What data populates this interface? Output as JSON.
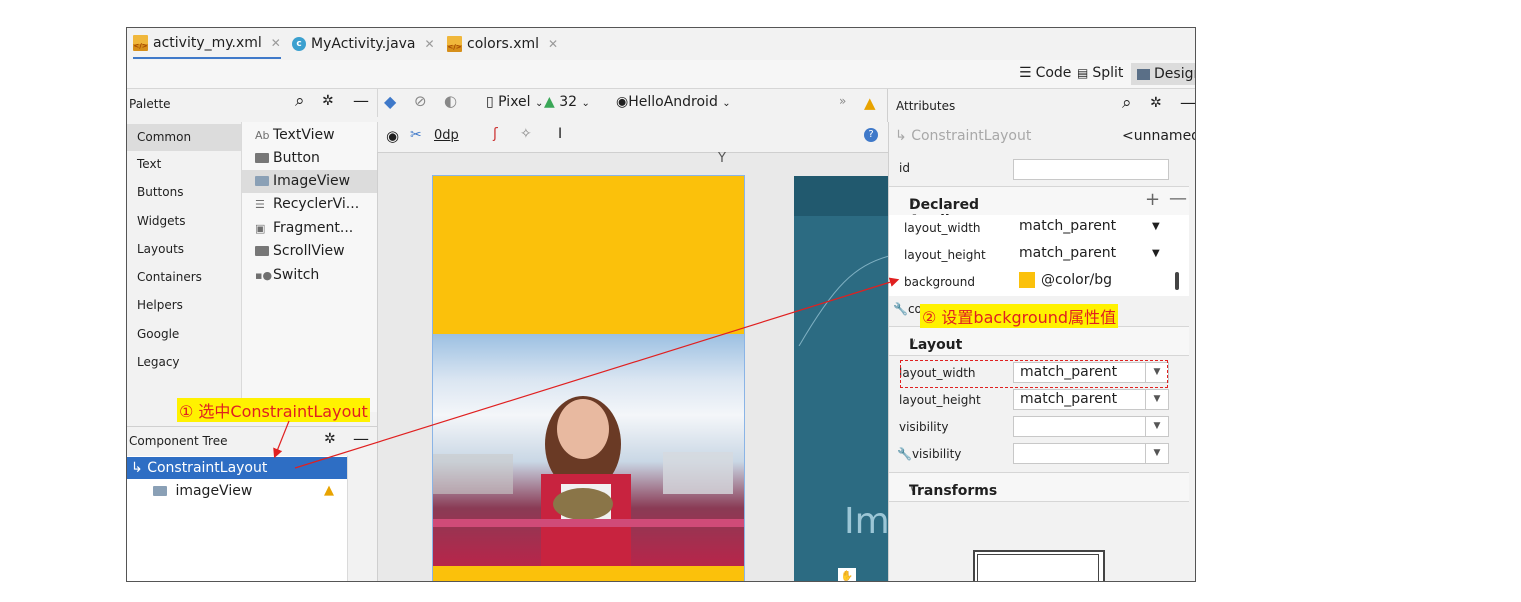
{
  "tabs": [
    {
      "label": "activity_my.xml",
      "active": true
    },
    {
      "label": "MyActivity.java",
      "active": false
    },
    {
      "label": "colors.xml",
      "active": false
    }
  ],
  "modes": {
    "code": "Code",
    "split": "Split",
    "design": "Design"
  },
  "palette": {
    "title": "Palette",
    "categories": [
      "Common",
      "Text",
      "Buttons",
      "Widgets",
      "Layouts",
      "Containers",
      "Helpers",
      "Google",
      "Legacy"
    ],
    "items": [
      {
        "icon": "Ab",
        "label": "TextView"
      },
      {
        "icon": "button",
        "label": "Button"
      },
      {
        "icon": "image",
        "label": "ImageView"
      },
      {
        "icon": "list",
        "label": "RecyclerVi..."
      },
      {
        "icon": "fragment",
        "label": "Fragment..."
      },
      {
        "icon": "scroll",
        "label": "ScrollView"
      },
      {
        "icon": "switch",
        "label": "Switch"
      }
    ]
  },
  "design_toolbar": {
    "device": "Pixel",
    "api": "32",
    "theme": "HelloAndroid",
    "margin": "0dp"
  },
  "component_tree": {
    "title": "Component Tree",
    "nodes": [
      {
        "label": "ConstraintLayout",
        "selected": true
      },
      {
        "label": "imageView",
        "selected": false,
        "warning": true
      }
    ]
  },
  "attributes": {
    "title": "Attributes",
    "component": "ConstraintLayout",
    "name": "<unnamed>",
    "id_label": "id",
    "declared_title": "Declared Attributes",
    "declared": [
      {
        "name": "layout_width",
        "value": "match_parent"
      },
      {
        "name": "layout_height",
        "value": "match_parent"
      },
      {
        "name": "background",
        "value": "@color/bg"
      }
    ],
    "co_label": "co",
    "layout_title": "Layout",
    "layout": [
      {
        "name": "layout_width",
        "value": "match_parent"
      },
      {
        "name": "layout_height",
        "value": "match_parent"
      },
      {
        "name": "visibility",
        "value": ""
      },
      {
        "name": "visibility",
        "value": ""
      }
    ],
    "transforms_title": "Transforms"
  },
  "annotations": {
    "step1": "① 选中ConstraintLayout",
    "step2": "② 设置background属性值"
  },
  "blueprint_text": "Im",
  "colors": {
    "accent_yellow": "#fbc10b",
    "selection_blue": "#2e6ec4",
    "annotation_red": "#e02020",
    "annotation_bg": "#fff200"
  }
}
